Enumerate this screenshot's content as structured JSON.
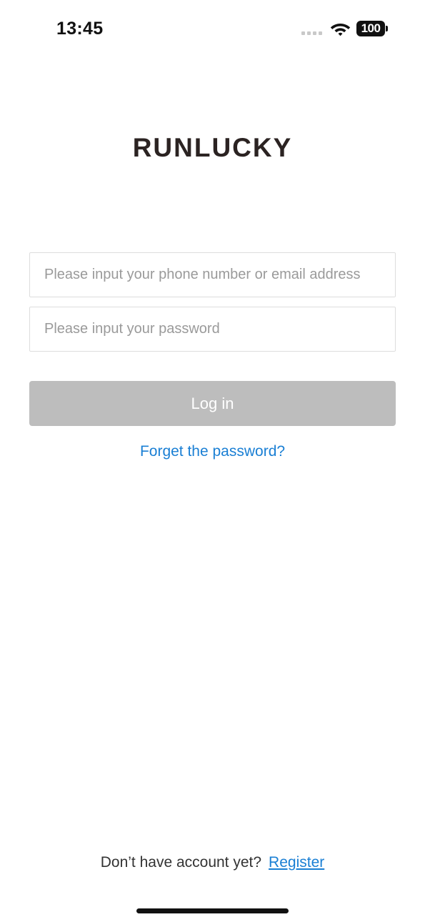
{
  "status_bar": {
    "time": "13:45",
    "battery": "100"
  },
  "logo": {
    "text": "RUNLUCKY"
  },
  "login_form": {
    "account_placeholder": "Please input your phone number or email address",
    "password_placeholder": "Please input your password",
    "login_label": "Log in",
    "forgot_label": "Forget the password?"
  },
  "footer": {
    "prompt": "Don’t have account yet?",
    "register_label": "Register"
  },
  "colors": {
    "link": "#1a7fd4",
    "button_disabled": "#bdbdbd",
    "logo": "#2b2322"
  }
}
